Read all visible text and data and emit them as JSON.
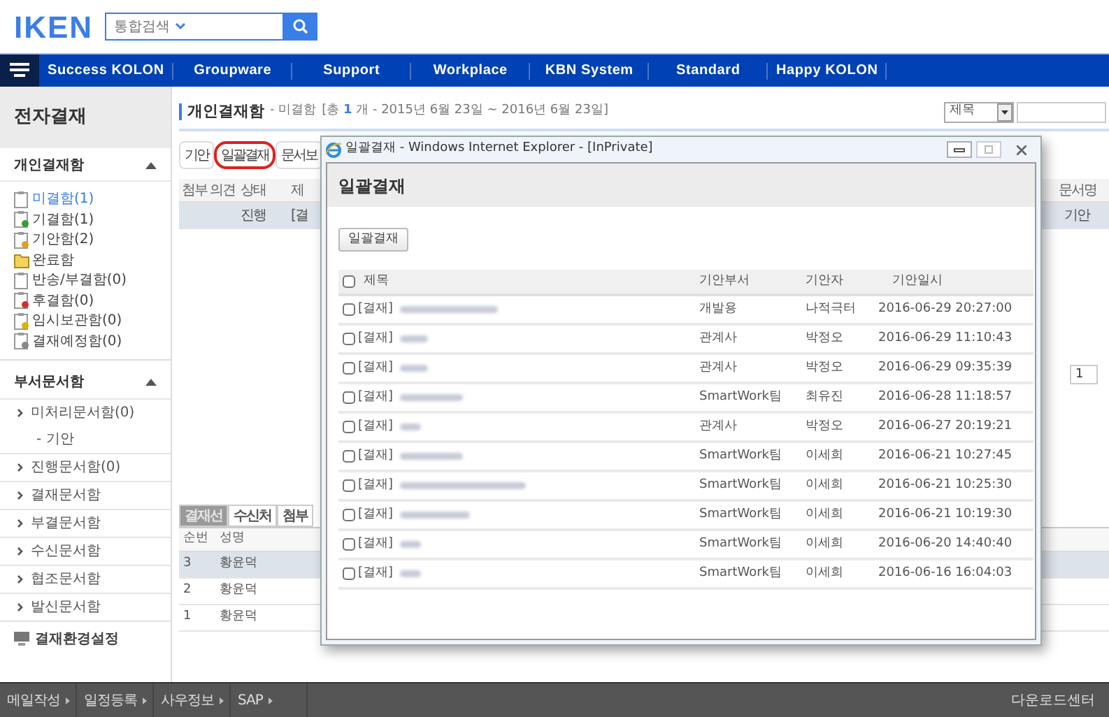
{
  "header": {
    "logo": "IKEN",
    "search_scope": "통합검색"
  },
  "nav": [
    "Success KOLON",
    "Groupware",
    "Support",
    "Workplace",
    "KBN System",
    "Standard",
    "Happy KOLON"
  ],
  "sidebar": {
    "title": "전자결재",
    "personal": {
      "title": "개인결재함",
      "expanded": true,
      "items": [
        {
          "label": "미결함(1)",
          "selected": true,
          "kind": "plain"
        },
        {
          "label": "기결함(1)",
          "selected": false,
          "kind": "done"
        },
        {
          "label": "기안함(2)",
          "selected": false,
          "kind": "edit"
        },
        {
          "label": "완료함",
          "selected": false,
          "kind": "folder"
        },
        {
          "label": "반송/부결함(0)",
          "selected": false,
          "kind": "plain"
        },
        {
          "label": "후결함(0)",
          "selected": false,
          "kind": "late"
        },
        {
          "label": "임시보관함(0)",
          "selected": false,
          "kind": "warn"
        },
        {
          "label": "결재예정함(0)",
          "selected": false,
          "kind": "clock"
        }
      ]
    },
    "dept": {
      "title": "부서문서함",
      "expanded": true,
      "items": [
        {
          "label": "미처리문서함(0)",
          "children": [
            {
              "label": "- 기안"
            }
          ]
        },
        {
          "label": "진행문서함(0)"
        },
        {
          "label": "결재문서함"
        },
        {
          "label": "부결문서함"
        },
        {
          "label": "수신문서함"
        },
        {
          "label": "협조문서함"
        },
        {
          "label": "발신문서함"
        }
      ]
    },
    "settings": "결재환경설정"
  },
  "main": {
    "title": "개인결재함",
    "subtitle": "- 미결함",
    "range": "[총 **1** 개 - 2015년 6월 23일 ~ 2016년 6월 23일]",
    "search_select": "제목",
    "tabs": [
      {
        "label": "기안",
        "circled": false
      },
      {
        "label": "일괄결재",
        "circled": true
      },
      {
        "label": "문서보",
        "circled": false
      }
    ],
    "list": {
      "columns": [
        "첨부",
        "의견",
        "상태",
        "제"
      ],
      "last_column": "문서명",
      "rows": [
        {
          "cells": [
            "",
            "",
            "진행",
            "[결"
          ],
          "last": "기안"
        }
      ]
    },
    "pagination": "1",
    "line_tabs": [
      {
        "label": "결재선",
        "selected": true
      },
      {
        "label": "수신처",
        "selected": false
      },
      {
        "label": "첨부",
        "selected": false
      }
    ],
    "line": {
      "columns": [
        "순번",
        "성명"
      ],
      "rows": [
        [
          "3",
          "황윤덕"
        ],
        [
          "2",
          "황윤덕"
        ],
        [
          "1",
          "황윤덕"
        ]
      ]
    }
  },
  "popup": {
    "window_title": "일괄결재 - Windows Internet Explorer - [InPrivate]",
    "heading": "일괄결재",
    "action": "일괄결재",
    "columns": [
      "제목",
      "기안부서",
      "기안자",
      "기안일시"
    ],
    "header_checked": false,
    "rows": [
      {
        "prefix": "[결재]",
        "dept": "개발용",
        "drafter": "나적극터",
        "date": "2016-06-29 20:27:00",
        "checked": false
      },
      {
        "prefix": "[결재]",
        "dept": "관계사",
        "drafter": "박정오",
        "date": "2016-06-29 11:10:43",
        "checked": false
      },
      {
        "prefix": "[결재]",
        "dept": "관계사",
        "drafter": "박정오",
        "date": "2016-06-29 09:35:39",
        "checked": false
      },
      {
        "prefix": "[결재]",
        "dept": "SmartWork팀",
        "drafter": "최유진",
        "date": "2016-06-28 11:18:57",
        "checked": false
      },
      {
        "prefix": "[결재]",
        "dept": "관계사",
        "drafter": "박정오",
        "date": "2016-06-27 20:19:21",
        "checked": false
      },
      {
        "prefix": "[결재]",
        "dept": "SmartWork팀",
        "drafter": "이세희",
        "date": "2016-06-21 10:27:45",
        "checked": false
      },
      {
        "prefix": "[결재]",
        "dept": "SmartWork팀",
        "drafter": "이세희",
        "date": "2016-06-21 10:25:30",
        "checked": false
      },
      {
        "prefix": "[결재]",
        "dept": "SmartWork팀",
        "drafter": "이세희",
        "date": "2016-06-21 10:19:30",
        "checked": false
      },
      {
        "prefix": "[결재]",
        "dept": "SmartWork팀",
        "drafter": "이세희",
        "date": "2016-06-20 14:40:40",
        "checked": false
      },
      {
        "prefix": "[결재]",
        "dept": "SmartWork팀",
        "drafter": "이세희",
        "date": "2016-06-16 16:04:03",
        "checked": false
      }
    ]
  },
  "footer": {
    "links": [
      "메일작성",
      "일정등록",
      "사우정보",
      "SAP"
    ],
    "right": "다운로드센터"
  }
}
